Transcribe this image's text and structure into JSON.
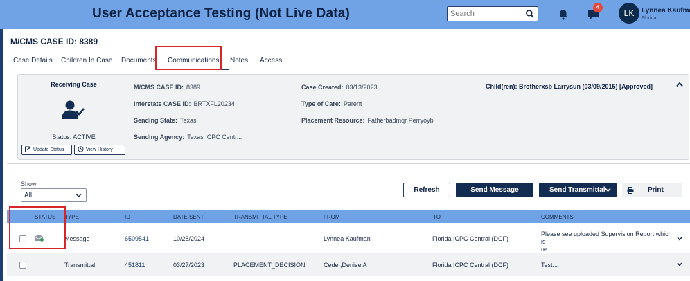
{
  "header": {
    "title": "User Acceptance Testing (Not Live Data)",
    "search_placeholder": "Search",
    "notification_count": "4",
    "user_initials": "LK",
    "user_name": "Lynnea Kaufman",
    "user_state": "Florida"
  },
  "page": {
    "case_id_title": "M/CMS CASE ID: 8389"
  },
  "tabs": [
    {
      "label": "Case Details"
    },
    {
      "label": "Children In Case"
    },
    {
      "label": "Documents"
    },
    {
      "label": "Communications",
      "active": true
    },
    {
      "label": "Notes"
    },
    {
      "label": "Access"
    }
  ],
  "case_card": {
    "receiving_label": "Receiving Case",
    "status_text": "Status: ACTIVE",
    "update_status_label": "Update Status",
    "view_history_label": "View History",
    "fields": {
      "mcms_case_id": {
        "label": "M/CMS CASE ID:",
        "value": "8389"
      },
      "interstate_case_id": {
        "label": "Interstate CASE ID:",
        "value": "BRTXFL20234"
      },
      "sending_state": {
        "label": "Sending State:",
        "value": "Texas"
      },
      "sending_agency": {
        "label": "Sending Agency:",
        "value": "Texas ICPC Centr..."
      },
      "case_created": {
        "label": "Case Created:",
        "value": "03/13/2023"
      },
      "type_of_care": {
        "label": "Type of Care:",
        "value": "Parent"
      },
      "placement_resource": {
        "label": "Placement Resource:",
        "value": "Fatherbadmqr Perryoyb"
      }
    },
    "children_text": "Child(ren): Brotherxsb Larrysun (03/09/2015)  [Approved]"
  },
  "controls": {
    "show_label": "Show",
    "show_value": "All",
    "refresh_label": "Refresh",
    "send_message_label": "Send Message",
    "send_transmittal_label": "Send Transmittal",
    "print_label": "Print"
  },
  "table": {
    "columns": [
      "STATUS",
      "TYPE",
      "ID",
      "DATE SENT",
      "TRANSMITTAL TYPE",
      "FROM",
      "TO",
      "COMMENTS"
    ],
    "rows": [
      {
        "type": "Message",
        "id": "6509541",
        "date_sent": "10/28/2024",
        "transmittal_type": "",
        "from": "Lynnea Kaufman",
        "to": "Florida ICPC Central (DCF)",
        "comments_line1": "Please see uploaded Supervision Report which is",
        "comments_line2": "re..."
      },
      {
        "type": "Transmittal",
        "id": "451811",
        "date_sent": "03/27/2023",
        "transmittal_type": "PLACEMENT_DECISION",
        "from": "Ceder,Denise A",
        "to": "Florida ICPC Central (DCF)",
        "comments_line1": "Test...",
        "comments_line2": ""
      }
    ]
  },
  "colors": {
    "header_bg": "#6fa3e6",
    "navy": "#132c52",
    "highlight_red": "#d8252a",
    "badge_red": "#e4463a"
  }
}
